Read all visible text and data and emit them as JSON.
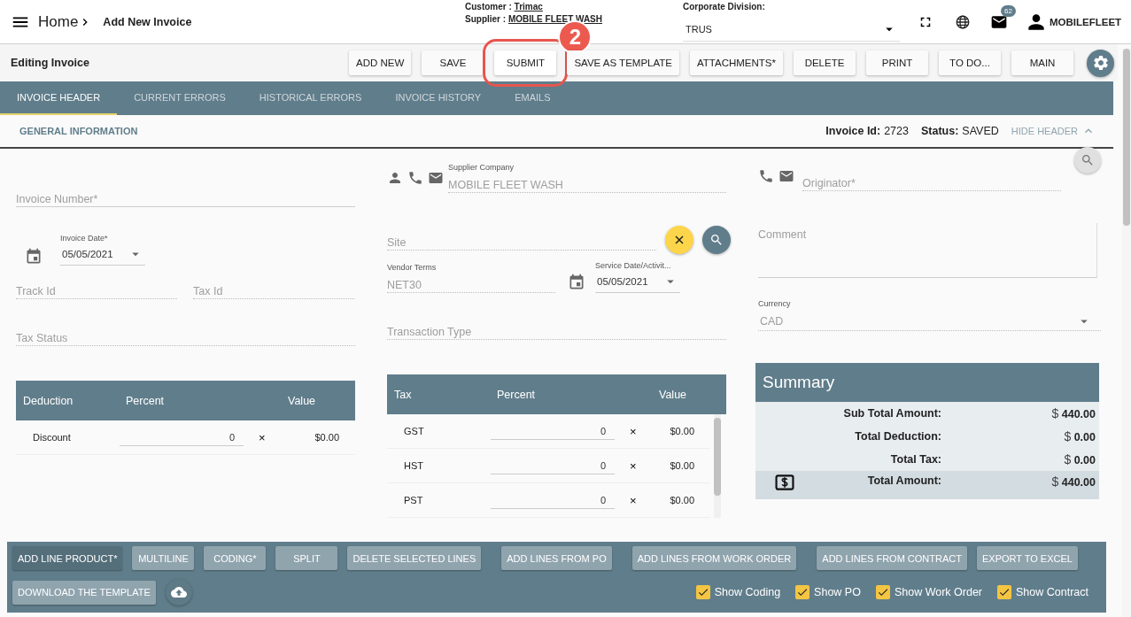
{
  "top_bar": {
    "home": "Home",
    "page_title": "Add New Invoice",
    "customer": {
      "label": "Customer :",
      "value": "Trimac"
    },
    "supplier": {
      "label": "Supplier :",
      "value": "MOBILE FLEET WASH"
    },
    "corporate_division": {
      "label": "Corporate Division:",
      "value": "TRUS"
    },
    "notification_count": "62",
    "user": "MOBILEFLEET"
  },
  "toolbar": {
    "title": "Editing Invoice",
    "buttons": [
      {
        "label": "ADD NEW",
        "highlighted": false
      },
      {
        "label": "SAVE",
        "highlighted": false
      },
      {
        "label": "SUBMIT",
        "highlighted": true,
        "callout": "2"
      },
      {
        "label": "SAVE AS TEMPLATE",
        "highlighted": false
      },
      {
        "label": "ATTACHMENTS*",
        "highlighted": false
      },
      {
        "label": "DELETE",
        "highlighted": false
      },
      {
        "label": "PRINT",
        "highlighted": false
      },
      {
        "label": "TO DO...",
        "highlighted": false
      },
      {
        "label": "MAIN",
        "highlighted": false
      }
    ]
  },
  "tabs": [
    {
      "label": "INVOICE HEADER",
      "selected": true
    },
    {
      "label": "CURRENT ERRORS",
      "selected": false
    },
    {
      "label": "HISTORICAL ERRORS",
      "selected": false
    },
    {
      "label": "INVOICE HISTORY",
      "selected": false
    },
    {
      "label": "EMAILS",
      "selected": false
    }
  ],
  "section": {
    "title": "GENERAL INFORMATION",
    "invoice_id": {
      "label": "Invoice Id:",
      "value": "2723"
    },
    "status": {
      "label": "Status:",
      "value": "SAVED"
    },
    "hide_header": "HIDE HEADER"
  },
  "form": {
    "invoice_number": {
      "placeholder": "Invoice Number*"
    },
    "invoice_date": {
      "label": "Invoice Date*",
      "value": "05/05/2021"
    },
    "track_id": {
      "placeholder": "Track Id"
    },
    "tax_id": {
      "placeholder": "Tax Id"
    },
    "tax_status": {
      "placeholder": "Tax Status"
    },
    "supplier_company": {
      "label": "Supplier Company",
      "value": "MOBILE FLEET WASH"
    },
    "site": {
      "placeholder": "Site"
    },
    "vendor_terms": {
      "label": "Vendor Terms",
      "value": "NET30"
    },
    "service_date": {
      "label": "Service Date/Activit...",
      "value": "05/05/2021"
    },
    "transaction_type": {
      "placeholder": "Transaction Type"
    },
    "originator": {
      "placeholder": "Originator*"
    },
    "comment": {
      "placeholder": "Comment"
    },
    "currency": {
      "label": "Currency",
      "value": "CAD"
    }
  },
  "deductions": {
    "columns": [
      "Deduction",
      "Percent",
      "Value"
    ],
    "rows": [
      {
        "name": "Discount",
        "percent": "0",
        "clear": "×",
        "value": "$0.00"
      }
    ]
  },
  "taxes": {
    "columns": [
      "Tax",
      "Percent",
      "Value"
    ],
    "rows": [
      {
        "name": "GST",
        "percent": "0",
        "clear": "×",
        "value": "$0.00"
      },
      {
        "name": "HST",
        "percent": "0",
        "clear": "×",
        "value": "$0.00"
      },
      {
        "name": "PST",
        "percent": "0",
        "clear": "×",
        "value": "$0.00"
      }
    ]
  },
  "summary": {
    "title": "Summary",
    "rows": [
      {
        "kind": "line",
        "label": "Sub Total Amount:",
        "currency": "$",
        "amount": "440.00"
      },
      {
        "kind": "line",
        "label": "Total Deduction:",
        "currency": "$",
        "amount": "0.00"
      },
      {
        "kind": "line",
        "label": "Total Tax:",
        "currency": "$",
        "amount": "0.00"
      },
      {
        "kind": "total",
        "label": "Total Amount:",
        "currency": "$",
        "amount": "440.00"
      }
    ]
  },
  "line_actions": {
    "buttons": [
      {
        "label": "ADD LINE PRODUCT*",
        "primary": true
      },
      {
        "label": "MULTILINE",
        "primary": false
      },
      {
        "label": "CODING*",
        "primary": false
      },
      {
        "label": "SPLIT",
        "primary": false
      },
      {
        "label": "DELETE SELECTED LINES",
        "primary": false
      },
      {
        "label": "ADD LINES FROM PO",
        "primary": false
      },
      {
        "label": "ADD LINES FROM WORK ORDER",
        "primary": false
      },
      {
        "label": "ADD LINES FROM CONTRACT",
        "primary": false
      },
      {
        "label": "EXPORT TO EXCEL",
        "primary": false
      }
    ],
    "template_button": "DOWNLOAD THE TEMPLATE",
    "toggles": [
      {
        "label": "Show Coding",
        "checked": true
      },
      {
        "label": "Show PO",
        "checked": true
      },
      {
        "label": "Show Work Order",
        "checked": true
      },
      {
        "label": "Show Contract",
        "checked": true
      }
    ]
  }
}
